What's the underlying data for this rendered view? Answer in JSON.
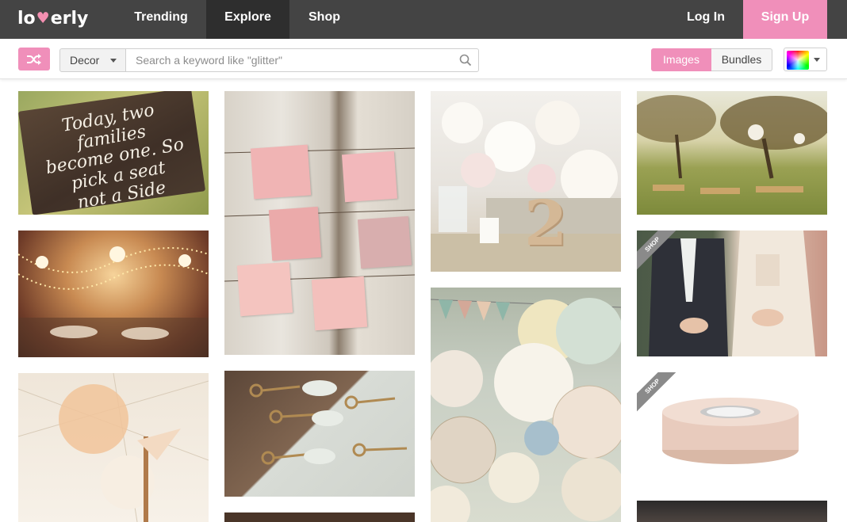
{
  "nav": {
    "logo": "lovely",
    "logo_pre": "lo",
    "logo_post": "erly",
    "items": [
      {
        "label": "Trending"
      },
      {
        "label": "Explore"
      },
      {
        "label": "Shop"
      }
    ],
    "login_label": "Log In",
    "signup_label": "Sign Up"
  },
  "toolbar": {
    "category": "Decor",
    "search_placeholder": "Search a keyword like \"glitter\"",
    "search_value": "",
    "view_images": "Images",
    "view_bundles": "Bundles",
    "active_view": "Images"
  },
  "tiles": {
    "sign": {
      "line1": "Today, two families",
      "line2": "become one. So",
      "line3": "pick a seat",
      "line4": "not a Side"
    },
    "shop_badge": "SHOP",
    "number": "2"
  },
  "colors": {
    "brand_pink": "#f08fba",
    "nav_bg": "#444444",
    "nav_active": "#2e2e2e"
  },
  "icons": [
    "shuffle-icon",
    "search-icon",
    "caret-down-icon",
    "heart-icon"
  ]
}
